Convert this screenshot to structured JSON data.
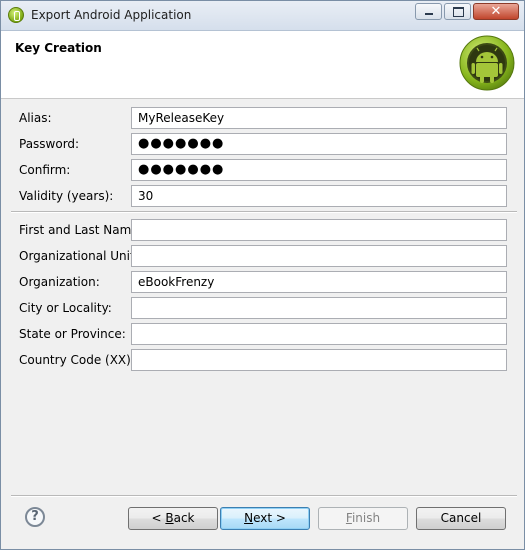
{
  "window": {
    "title": "Export Android Application",
    "minimize": "minimize",
    "maximize": "maximize",
    "close_glyph": "✕"
  },
  "header": {
    "title": "Key Creation",
    "logo_icon": "android-logo-icon"
  },
  "form": {
    "key": [
      {
        "name": "alias",
        "label": "Alias:",
        "value": "MyReleaseKey"
      },
      {
        "name": "password",
        "label": "Password:",
        "value": "●●●●●●●"
      },
      {
        "name": "confirm",
        "label": "Confirm:",
        "value": "●●●●●●●"
      },
      {
        "name": "validity",
        "label": "Validity (years):",
        "value": "30"
      }
    ],
    "owner": [
      {
        "name": "first-last-name",
        "label": "First and Last Name:",
        "value": ""
      },
      {
        "name": "organizational-unit",
        "label": "Organizational Unit:",
        "value": ""
      },
      {
        "name": "organization",
        "label": "Organization:",
        "value": "eBookFrenzy"
      },
      {
        "name": "city-locality",
        "label": "City or Locality:",
        "value": ""
      },
      {
        "name": "state-province",
        "label": "State or Province:",
        "value": ""
      },
      {
        "name": "country-code",
        "label": "Country Code (XX):",
        "value": ""
      }
    ]
  },
  "footer": {
    "help_glyph": "?",
    "back": {
      "prefix": "< ",
      "mnemonic": "B",
      "rest": "ack"
    },
    "next": {
      "mnemonic": "N",
      "rest": "ext >"
    },
    "finish": {
      "mnemonic": "F",
      "rest": "inish"
    },
    "cancel": "Cancel"
  },
  "colors": {
    "android_green": "#a4c639",
    "default_button_border": "#3c7fb1"
  }
}
